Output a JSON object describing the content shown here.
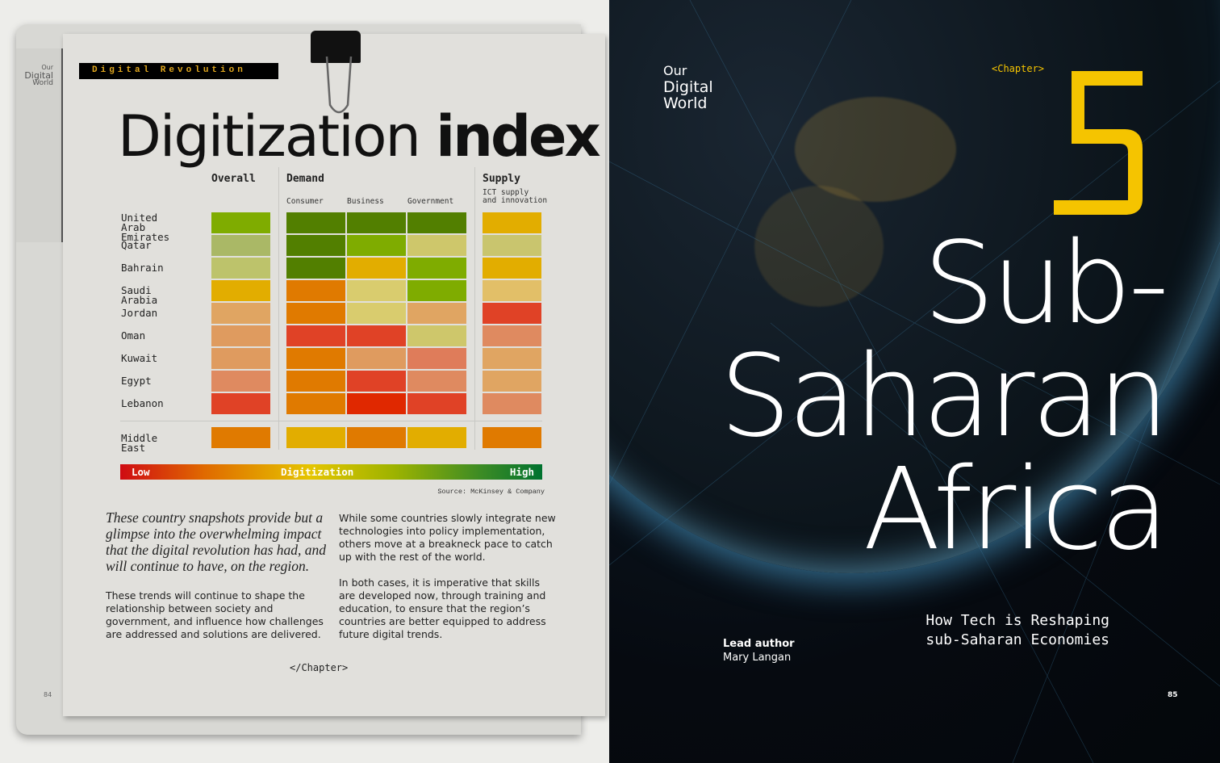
{
  "left_page": {
    "tab_label": [
      "Our",
      "Digital",
      "World"
    ],
    "section_banner": "Digital Revolution",
    "title_light": "Digitization ",
    "title_bold": "index",
    "page_number": "84",
    "footer_tag": "</Chapter>",
    "quote": "These country snapshots provide but a glimpse into the overwhelming impact that the digital revolution has had, and will continue to have, on the region.",
    "body_left": "These trends will continue to shape the relationship between society and government, and influence how challenges are addressed and solutions are delivered.",
    "body_right_1": "While some countries slowly integrate new technologies into policy implementation, others move at a breakneck pace to catch up with the rest of the world.",
    "body_right_2": "In both cases, it is imperative that skills are developed now, through training and education, to ensure that the region’s countries are better equipped to address future digital trends."
  },
  "chart_data": {
    "type": "heatmap",
    "groups": [
      {
        "label": "Overall",
        "columns": [
          ""
        ]
      },
      {
        "label": "Demand",
        "columns": [
          "Consumer",
          "Business",
          "Government"
        ]
      },
      {
        "label": "Supply",
        "columns": [
          "ICT supply and innovation"
        ]
      }
    ],
    "supply_sub_lines": [
      "ICT supply",
      "and innovation"
    ],
    "rows": [
      "United Arab Emirates",
      "Qatar",
      "Bahrain",
      "Saudi Arabia",
      "Jordan",
      "Oman",
      "Kuwait",
      "Egypt",
      "Lebanon"
    ],
    "row_label_lines": [
      [
        "United Arab",
        "Emirates"
      ],
      [
        "Qatar"
      ],
      [
        "Bahrain"
      ],
      [
        "Saudi Arabia"
      ],
      [
        "Jordan"
      ],
      [
        "Oman"
      ],
      [
        "Kuwait"
      ],
      [
        "Egypt"
      ],
      [
        "Lebanon"
      ]
    ],
    "cell_colors": [
      [
        "#7fac00",
        "#527f00",
        "#527f00",
        "#527f00",
        "#e2ad00"
      ],
      [
        "#aab866",
        "#527f00",
        "#7fac00",
        "#cec76b",
        "#c9c56e"
      ],
      [
        "#bdc36b",
        "#527f00",
        "#e2ad00",
        "#7fac00",
        "#e2ad00"
      ],
      [
        "#e2ad00",
        "#e07a00",
        "#d9cc6e",
        "#7fac00",
        "#e2bf68"
      ],
      [
        "#e0a562",
        "#e07a00",
        "#d9cc6e",
        "#e0a562",
        "#e04226"
      ],
      [
        "#df9b5f",
        "#e04226",
        "#e04226",
        "#cec76b",
        "#df8a60"
      ],
      [
        "#df9b5f",
        "#e07a00",
        "#df9b5f",
        "#df7c5a",
        "#e0a562"
      ],
      [
        "#df8a60",
        "#e07a00",
        "#e04226",
        "#df8a60",
        "#e0a562"
      ],
      [
        "#e04226",
        "#e07a00",
        "#e02800",
        "#e04226",
        "#df8a60"
      ]
    ],
    "aggregate": {
      "label": "Middle East",
      "colors": [
        "#e07a00",
        "#e2ad00",
        "#e07a00",
        "#e2ad00",
        "#e07a00"
      ]
    },
    "legend": {
      "low": "Low",
      "title": "Digitization",
      "high": "High",
      "low_color": "#cf0b13",
      "high_color": "#00722f"
    },
    "source": "Source: McKinsey & Company"
  },
  "right_page": {
    "tab_label": [
      "Our",
      "Digital",
      "World"
    ],
    "chapter_tag": "<Chapter>",
    "chapter_number": "5",
    "accent_color": "#f5c400",
    "headline": [
      "Sub-",
      "Saharan",
      "Africa"
    ],
    "subtitle": [
      "How Tech is Reshaping",
      "sub-Saharan Economies"
    ],
    "author_label": "Lead author",
    "author_name": "Mary Langan",
    "page_number": "85"
  }
}
